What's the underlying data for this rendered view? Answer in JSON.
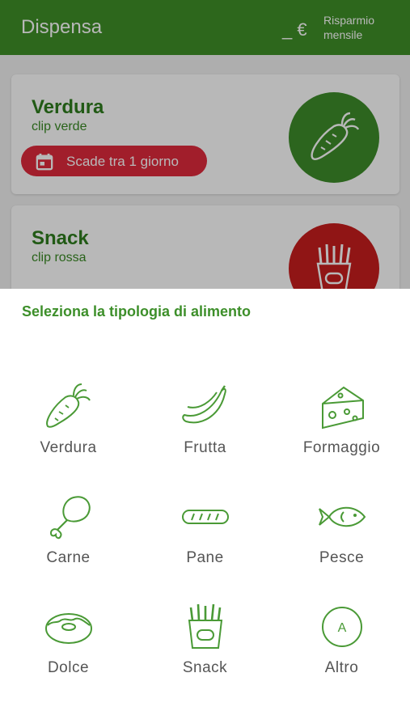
{
  "appbar": {
    "title": "Dispensa",
    "savings_value": "_ €",
    "savings_label": "Risparmio mensile"
  },
  "cards": [
    {
      "name": "Verdura",
      "clip": "clip verde",
      "expiry": "Scade tra 1 giorno",
      "circle_color": "#3e8c2a",
      "icon": "carrot-icon"
    },
    {
      "name": "Snack",
      "clip": "clip rossa",
      "circle_color": "#c81e1e",
      "icon": "fries-icon"
    }
  ],
  "sheet": {
    "heading": "Seleziona la tipologia di alimento",
    "categories": [
      {
        "label": "Verdura",
        "icon": "carrot-icon"
      },
      {
        "label": "Frutta",
        "icon": "banana-icon"
      },
      {
        "label": "Formaggio",
        "icon": "cheese-icon"
      },
      {
        "label": "Carne",
        "icon": "drumstick-icon"
      },
      {
        "label": "Pane",
        "icon": "bread-icon"
      },
      {
        "label": "Pesce",
        "icon": "fish-icon"
      },
      {
        "label": "Dolce",
        "icon": "donut-icon"
      },
      {
        "label": "Snack",
        "icon": "fries-icon"
      },
      {
        "label": "Altro",
        "icon": "other-a-icon",
        "icon_text": "A"
      }
    ]
  },
  "colors": {
    "primary": "#3f8f28",
    "alert": "#e02a3c",
    "snack": "#c81e1e"
  }
}
